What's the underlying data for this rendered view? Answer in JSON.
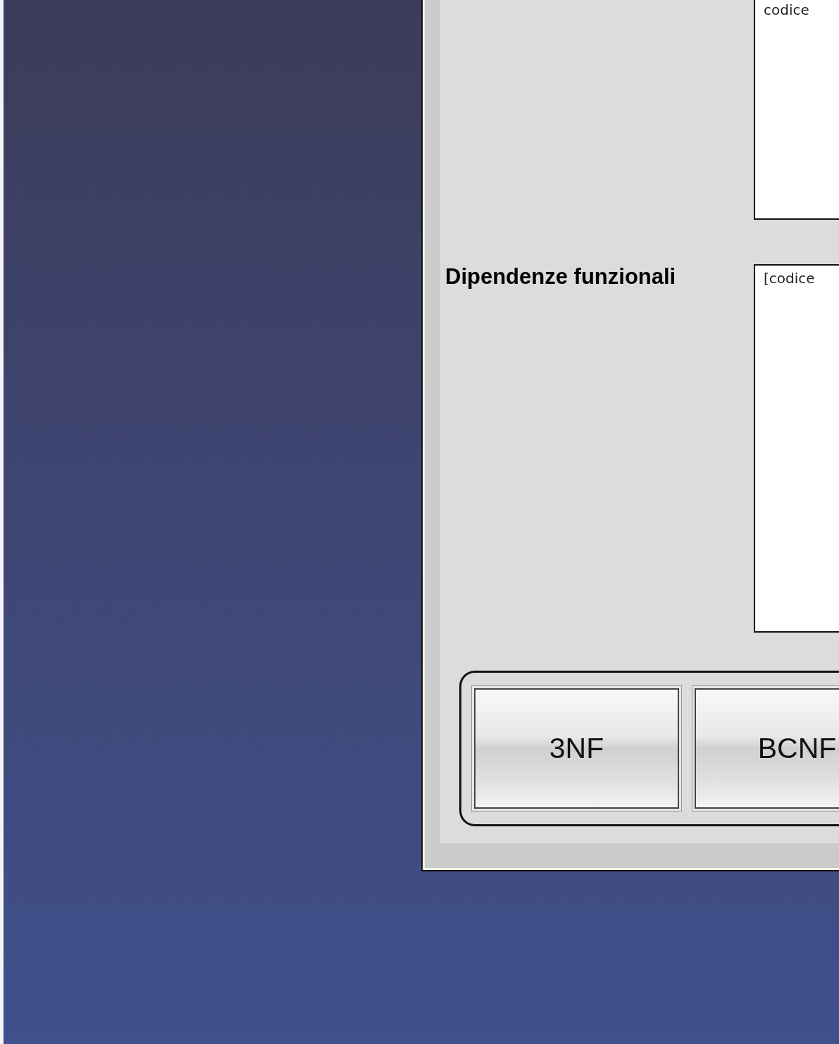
{
  "attributes_field": {
    "value": "codice"
  },
  "dependencies": {
    "label": "Dipendenze funzionali",
    "value": "[codice"
  },
  "buttons": [
    {
      "label": "3NF"
    },
    {
      "label": "BCNF"
    }
  ]
}
